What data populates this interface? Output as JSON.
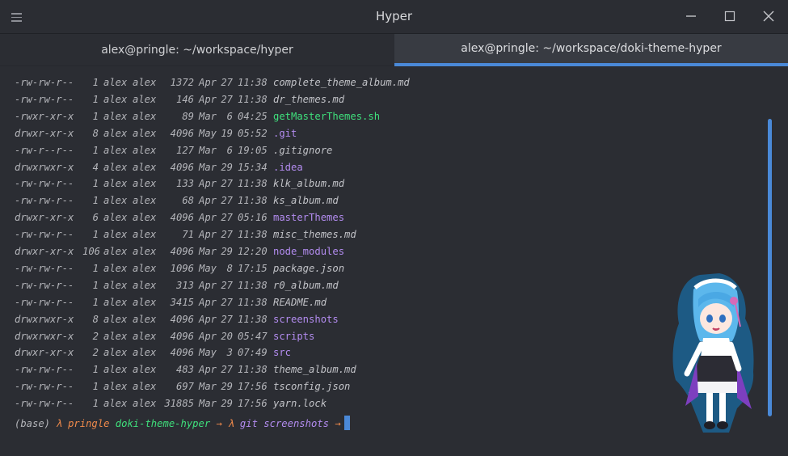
{
  "window": {
    "title": "Hyper"
  },
  "tabs": [
    {
      "label": "alex@pringle: ~/workspace/hyper",
      "active": false
    },
    {
      "label": "alex@pringle: ~/workspace/doki-theme-hyper",
      "active": true
    }
  ],
  "listing": [
    {
      "perm": "-rw-rw-r--",
      "links": "1",
      "user": "alex",
      "group": "alex",
      "size": "1372",
      "month": "Apr",
      "day": "27",
      "time": "11:38",
      "name": "complete_theme_album.md",
      "kind": "file"
    },
    {
      "perm": "-rw-rw-r--",
      "links": "1",
      "user": "alex",
      "group": "alex",
      "size": "146",
      "month": "Apr",
      "day": "27",
      "time": "11:38",
      "name": "dr_themes.md",
      "kind": "file"
    },
    {
      "perm": "-rwxr-xr-x",
      "links": "1",
      "user": "alex",
      "group": "alex",
      "size": "89",
      "month": "Mar",
      "day": "6",
      "time": "04:25",
      "name": "getMasterThemes.sh",
      "kind": "exec"
    },
    {
      "perm": "drwxr-xr-x",
      "links": "8",
      "user": "alex",
      "group": "alex",
      "size": "4096",
      "month": "May",
      "day": "19",
      "time": "05:52",
      "name": ".git",
      "kind": "dir"
    },
    {
      "perm": "-rw-r--r--",
      "links": "1",
      "user": "alex",
      "group": "alex",
      "size": "127",
      "month": "Mar",
      "day": "6",
      "time": "19:05",
      "name": ".gitignore",
      "kind": "file"
    },
    {
      "perm": "drwxrwxr-x",
      "links": "4",
      "user": "alex",
      "group": "alex",
      "size": "4096",
      "month": "Mar",
      "day": "29",
      "time": "15:34",
      "name": ".idea",
      "kind": "dir"
    },
    {
      "perm": "-rw-rw-r--",
      "links": "1",
      "user": "alex",
      "group": "alex",
      "size": "133",
      "month": "Apr",
      "day": "27",
      "time": "11:38",
      "name": "klk_album.md",
      "kind": "file"
    },
    {
      "perm": "-rw-rw-r--",
      "links": "1",
      "user": "alex",
      "group": "alex",
      "size": "68",
      "month": "Apr",
      "day": "27",
      "time": "11:38",
      "name": "ks_album.md",
      "kind": "file"
    },
    {
      "perm": "drwxr-xr-x",
      "links": "6",
      "user": "alex",
      "group": "alex",
      "size": "4096",
      "month": "Apr",
      "day": "27",
      "time": "05:16",
      "name": "masterThemes",
      "kind": "dir"
    },
    {
      "perm": "-rw-rw-r--",
      "links": "1",
      "user": "alex",
      "group": "alex",
      "size": "71",
      "month": "Apr",
      "day": "27",
      "time": "11:38",
      "name": "misc_themes.md",
      "kind": "file"
    },
    {
      "perm": "drwxr-xr-x",
      "links": "106",
      "user": "alex",
      "group": "alex",
      "size": "4096",
      "month": "Mar",
      "day": "29",
      "time": "12:20",
      "name": "node_modules",
      "kind": "dir"
    },
    {
      "perm": "-rw-rw-r--",
      "links": "1",
      "user": "alex",
      "group": "alex",
      "size": "1096",
      "month": "May",
      "day": "8",
      "time": "17:15",
      "name": "package.json",
      "kind": "file"
    },
    {
      "perm": "-rw-rw-r--",
      "links": "1",
      "user": "alex",
      "group": "alex",
      "size": "313",
      "month": "Apr",
      "day": "27",
      "time": "11:38",
      "name": "r0_album.md",
      "kind": "file"
    },
    {
      "perm": "-rw-rw-r--",
      "links": "1",
      "user": "alex",
      "group": "alex",
      "size": "3415",
      "month": "Apr",
      "day": "27",
      "time": "11:38",
      "name": "README.md",
      "kind": "file"
    },
    {
      "perm": "drwxrwxr-x",
      "links": "8",
      "user": "alex",
      "group": "alex",
      "size": "4096",
      "month": "Apr",
      "day": "27",
      "time": "11:38",
      "name": "screenshots",
      "kind": "dir"
    },
    {
      "perm": "drwxrwxr-x",
      "links": "2",
      "user": "alex",
      "group": "alex",
      "size": "4096",
      "month": "Apr",
      "day": "20",
      "time": "05:47",
      "name": "scripts",
      "kind": "dir"
    },
    {
      "perm": "drwxr-xr-x",
      "links": "2",
      "user": "alex",
      "group": "alex",
      "size": "4096",
      "month": "May",
      "day": "3",
      "time": "07:49",
      "name": "src",
      "kind": "dir"
    },
    {
      "perm": "-rw-rw-r--",
      "links": "1",
      "user": "alex",
      "group": "alex",
      "size": "483",
      "month": "Apr",
      "day": "27",
      "time": "11:38",
      "name": "theme_album.md",
      "kind": "file"
    },
    {
      "perm": "-rw-rw-r--",
      "links": "1",
      "user": "alex",
      "group": "alex",
      "size": "697",
      "month": "Mar",
      "day": "29",
      "time": "17:56",
      "name": "tsconfig.json",
      "kind": "file"
    },
    {
      "perm": "-rw-rw-r--",
      "links": "1",
      "user": "alex",
      "group": "alex",
      "size": "31885",
      "month": "Mar",
      "day": "29",
      "time": "17:56",
      "name": "yarn.lock",
      "kind": "file"
    }
  ],
  "prompt": {
    "env": "(base)",
    "lambda1": "λ",
    "host": "pringle",
    "dir": "doki-theme-hyper",
    "arrow1": "→",
    "lambda2": "λ",
    "git": "git",
    "branch": "screenshots",
    "arrow2": "→"
  },
  "colors": {
    "background": "#2b2d33",
    "accent": "#4a89d8",
    "directory": "#b38cf0",
    "executable": "#3fe07c",
    "prompt_orange": "#f08a4b"
  },
  "icons": {
    "menu": "hamburger-menu-icon",
    "minimize": "minimize-icon",
    "maximize": "maximize-icon",
    "close": "close-icon"
  }
}
